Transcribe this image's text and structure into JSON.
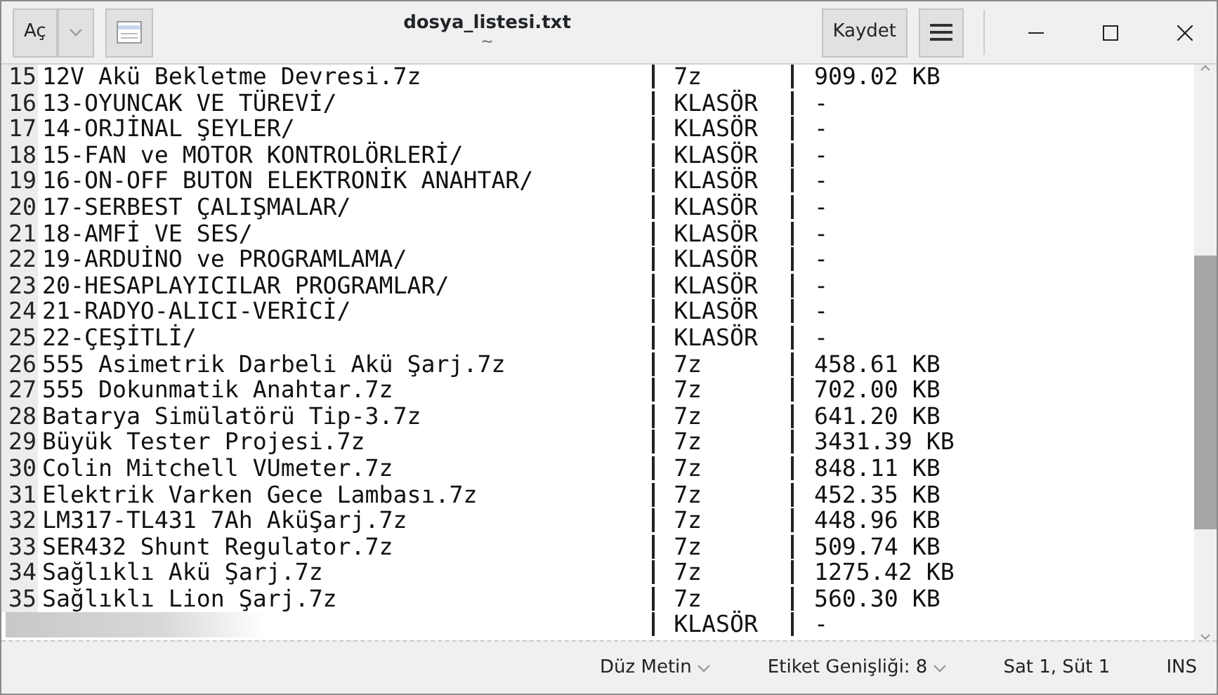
{
  "window": {
    "title": "dosya_listesi.txt",
    "subtitle": "~"
  },
  "header": {
    "open_button": "Aç",
    "save_button": "Kaydet"
  },
  "lines": [
    {
      "kind": "entry",
      "number": "15",
      "name": "12V Akü Bekletme Devresi.7z",
      "type": "7z",
      "size": "909.02 KB"
    },
    {
      "kind": "entry",
      "number": "16",
      "name": "13-OYUNCAK VE TÜREVİ/",
      "type": "KLASÖR",
      "size": "-"
    },
    {
      "kind": "entry",
      "number": "17",
      "name": "14-ORJİNAL ŞEYLER/",
      "type": "KLASÖR",
      "size": "-"
    },
    {
      "kind": "entry",
      "number": "18",
      "name": "15-FAN ve MOTOR KONTROLÖRLERİ/",
      "type": "KLASÖR",
      "size": "-"
    },
    {
      "kind": "entry",
      "number": "19",
      "name": "16-ON-OFF BUTON ELEKTRONİK ANAHTAR/",
      "type": "KLASÖR",
      "size": "-"
    },
    {
      "kind": "entry",
      "number": "20",
      "name": "17-SERBEST ÇALIŞMALAR/",
      "type": "KLASÖR",
      "size": "-"
    },
    {
      "kind": "entry",
      "number": "21",
      "name": "18-AMFİ VE SES/",
      "type": "KLASÖR",
      "size": "-"
    },
    {
      "kind": "entry",
      "number": "22",
      "name": "19-ARDUİNO ve PROGRAMLAMA/",
      "type": "KLASÖR",
      "size": "-"
    },
    {
      "kind": "entry",
      "number": "23",
      "name": "20-HESAPLAYICILAR PROGRAMLAR/",
      "type": "KLASÖR",
      "size": "-"
    },
    {
      "kind": "entry",
      "number": "24",
      "name": "21-RADYO-ALICI-VERİCİ/",
      "type": "KLASÖR",
      "size": "-"
    },
    {
      "kind": "entry",
      "number": "25",
      "name": "22-ÇEŞİTLİ/",
      "type": "KLASÖR",
      "size": "-"
    },
    {
      "kind": "entry",
      "number": "26",
      "name": "555 Asimetrik Darbeli Akü Şarj.7z",
      "type": "7z",
      "size": "458.61 KB"
    },
    {
      "kind": "entry",
      "number": "27",
      "name": "555 Dokunmatik Anahtar.7z",
      "type": "7z",
      "size": "702.00 KB"
    },
    {
      "kind": "entry",
      "number": "28",
      "name": "Batarya Simülatörü Tip-3.7z",
      "type": "7z",
      "size": "641.20 KB"
    },
    {
      "kind": "entry",
      "number": "29",
      "name": "Büyük Tester Projesi.7z",
      "type": "7z",
      "size": "3431.39 KB"
    },
    {
      "kind": "entry",
      "number": "30",
      "name": "Colin Mitchell VUmeter.7z",
      "type": "7z",
      "size": "848.11 KB"
    },
    {
      "kind": "entry",
      "number": "31",
      "name": "Elektrik Varken Gece Lambası.7z",
      "type": "7z",
      "size": "452.35 KB"
    },
    {
      "kind": "entry",
      "number": "32",
      "name": "LM317-TL431 7Ah AküŞarj.7z",
      "type": "7z",
      "size": "448.96 KB"
    },
    {
      "kind": "entry",
      "number": "33",
      "name": "SER432 Shunt Regulator.7z",
      "type": "7z",
      "size": "509.74 KB"
    },
    {
      "kind": "entry",
      "number": "34",
      "name": "Sağlıklı Akü Şarj.7z",
      "type": "7z",
      "size": "1275.42 KB"
    },
    {
      "kind": "entry",
      "number": "35",
      "name": "Sağlıklı Lion Şarj.7z",
      "type": "7z",
      "size": "560.30 KB"
    },
    {
      "kind": "obscured",
      "type": "KLASÖR",
      "size": "-"
    }
  ],
  "status_bar": {
    "language": "Düz Metin",
    "tab_width": "Etiket Genişliği: 8",
    "position": "Sat 1, Süt 1",
    "mode": "INS"
  }
}
